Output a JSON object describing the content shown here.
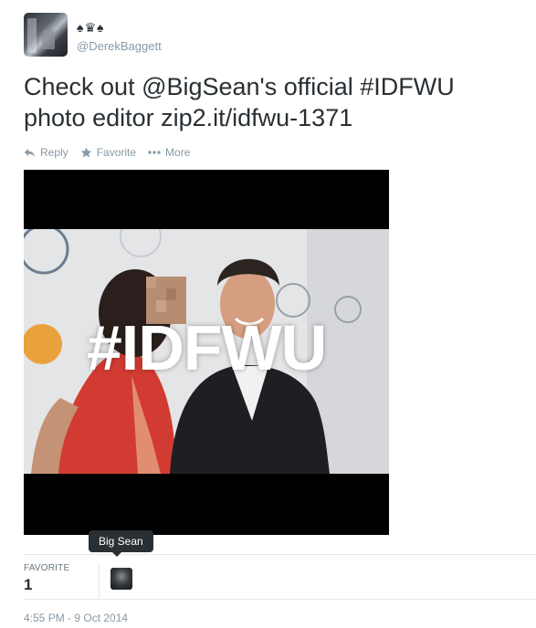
{
  "author": {
    "handle": "@DerekBaggett",
    "name_glyphs": "♠♛♠",
    "avatar_icon": "profile-photo"
  },
  "tweet": {
    "text_line1": "Check out @BigSean's official #IDFWU",
    "text_line2": "photo editor zip2.it/idfwu-1371",
    "media_caption": "#IDFWU"
  },
  "actions": {
    "reply_label": "Reply",
    "favorite_label": "Favorite",
    "more_label": "More"
  },
  "stats": {
    "favorite_label": "FAVORITE",
    "favorite_count": "1"
  },
  "tooltip": {
    "text": "Big Sean"
  },
  "timestamp": "4:55 PM - 9 Oct 2014",
  "colors": {
    "text": "#292f33",
    "muted": "#8899a6",
    "divider": "#e1e8ed",
    "tooltip_bg": "#292f33"
  }
}
